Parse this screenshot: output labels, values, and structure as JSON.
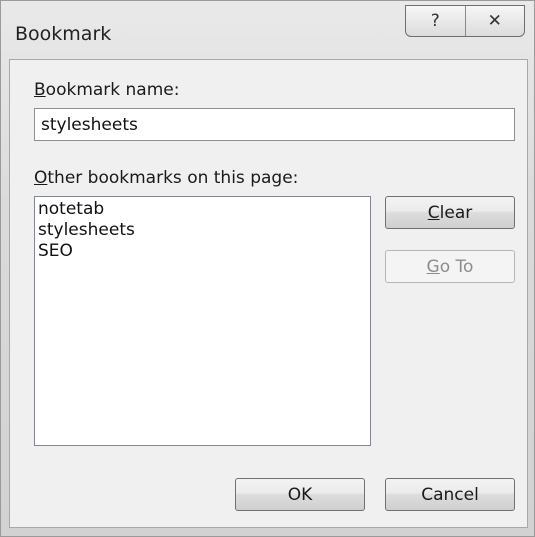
{
  "window": {
    "title": "Bookmark",
    "help_glyph": "?",
    "close_glyph": "✕"
  },
  "bookmark_name": {
    "label_mnemonic": "B",
    "label_rest": "ookmark name:",
    "value": "stylesheets"
  },
  "other_bookmarks": {
    "label_mnemonic": "O",
    "label_rest": "ther bookmarks on this page:",
    "items": [
      "notetab",
      "stylesheets",
      "SEO"
    ]
  },
  "buttons": {
    "clear_mnemonic": "C",
    "clear_rest": "lear",
    "goto_mnemonic": "G",
    "goto_rest": "o To",
    "ok": "OK",
    "cancel": "Cancel"
  }
}
